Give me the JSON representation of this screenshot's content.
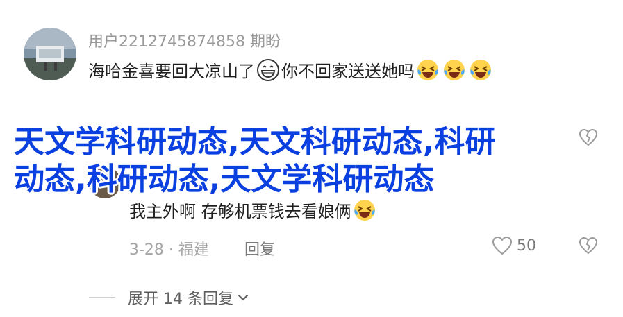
{
  "comment": {
    "username": "用户2212745874858 期盼",
    "text_part1": "海哈金喜要回大凉山了",
    "text_part2": "你不回家送送她吗",
    "emojis": [
      "grin-emoji",
      "laughing-tears-emoji"
    ]
  },
  "overlay": {
    "line1": "天文学科研动态,天文科研动态,科研",
    "line2": "动态,科研动态,天文学科研动态"
  },
  "reply": {
    "text": "我主外啊 存够机票钱去看娘俩",
    "date_location": "3-28 · 福建",
    "reply_label": "回复",
    "like_count": "50"
  },
  "expand": {
    "label": "展开 14 条回复"
  },
  "colors": {
    "overlay_text": "#0a3fe0",
    "meta_text": "#a5a5a5",
    "body_text": "#1f1f1f"
  }
}
